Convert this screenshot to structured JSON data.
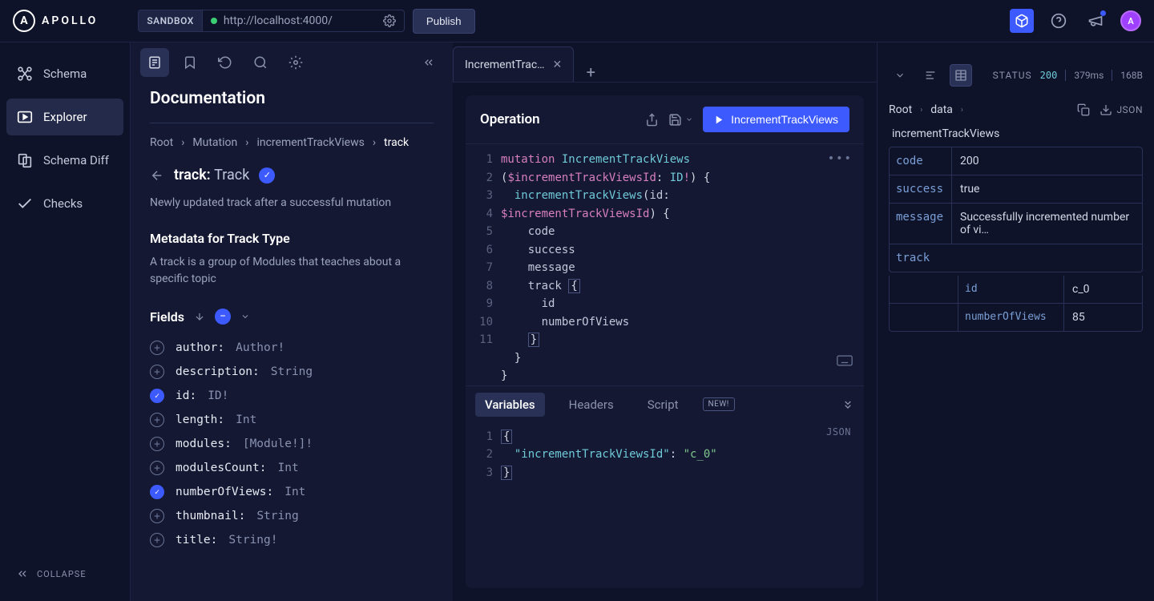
{
  "topbar": {
    "logo": "APOLLO",
    "sandbox_badge": "SANDBOX",
    "url": "http://localhost:4000/",
    "publish": "Publish",
    "avatar": "A"
  },
  "sidebar": {
    "items": [
      {
        "label": "Schema"
      },
      {
        "label": "Explorer"
      },
      {
        "label": "Schema Diff"
      },
      {
        "label": "Checks"
      }
    ],
    "collapse": "COLLAPSE"
  },
  "docs": {
    "title": "Documentation",
    "breadcrumb": [
      "Root",
      "Mutation",
      "incrementTrackViews",
      "track"
    ],
    "type_field": "track:",
    "type_name": "Track",
    "type_desc": "Newly updated track after a successful mutation",
    "meta_heading": "Metadata for Track Type",
    "meta_desc": "A track is a group of Modules that teaches about a specific topic",
    "fields_label": "Fields",
    "fields": [
      {
        "name": "author:",
        "type": "Author!",
        "checked": false
      },
      {
        "name": "description:",
        "type": "String",
        "checked": false
      },
      {
        "name": "id:",
        "type": "ID!",
        "checked": true
      },
      {
        "name": "length:",
        "type": "Int",
        "checked": false
      },
      {
        "name": "modules:",
        "type": "[Module!]!",
        "checked": false
      },
      {
        "name": "modulesCount:",
        "type": "Int",
        "checked": false
      },
      {
        "name": "numberOfViews:",
        "type": "Int",
        "checked": true
      },
      {
        "name": "thumbnail:",
        "type": "String",
        "checked": false
      },
      {
        "name": "title:",
        "type": "String!",
        "checked": false
      }
    ]
  },
  "editor": {
    "tab_name": "IncrementTrac…",
    "operation_label": "Operation",
    "run_label": "IncrementTrackViews",
    "code_tokens": {
      "l1_kw": "mutation",
      "l1_fn": "IncrementTrackViews",
      "l2_var": "$incrementTrackViewsId",
      "l2_typ": "ID",
      "l3_fn": "incrementTrackViews",
      "l3_arg": "id",
      "l4_var": "$incrementTrackViewsId",
      "l5": "code",
      "l6": "success",
      "l7": "message",
      "l8": "track",
      "l9": "id",
      "l10": "numberOfViews"
    },
    "bottom_tabs": {
      "variables": "Variables",
      "headers": "Headers",
      "script": "Script",
      "new": "NEW!"
    },
    "vars_key": "\"incrementTrackViewsId\"",
    "vars_val": "\"c_0\"",
    "json_tag": "JSON"
  },
  "response": {
    "status_label": "STATUS",
    "status_code": "200",
    "time": "379ms",
    "size": "168B",
    "crumb": [
      "Root",
      "data"
    ],
    "json_label": "JSON",
    "root_field": "incrementTrackViews",
    "rows": [
      {
        "k": "code",
        "v": "200"
      },
      {
        "k": "success",
        "v": "true"
      },
      {
        "k": "message",
        "v": "Successfully incremented number of vi…"
      }
    ],
    "track_label": "track",
    "track_rows": [
      {
        "k": "id",
        "v": "c_0"
      },
      {
        "k": "numberOfViews",
        "v": "85"
      }
    ]
  }
}
